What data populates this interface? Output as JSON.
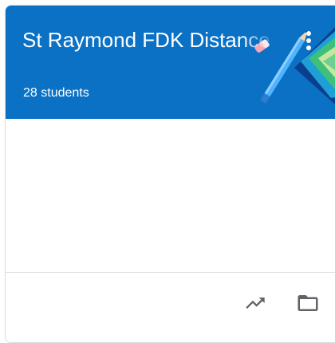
{
  "theme": {
    "header_color": "#0b71c5",
    "icon_color": "#5f6368"
  },
  "class_card": {
    "title": "St Raymond FDK Distance",
    "student_count": "28 students",
    "more_icon": "more-vert-icon",
    "header_illustration": "pencil-and-books"
  },
  "footer": {
    "actions": [
      {
        "icon": "trending-up-icon"
      },
      {
        "icon": "folder-icon"
      }
    ]
  }
}
